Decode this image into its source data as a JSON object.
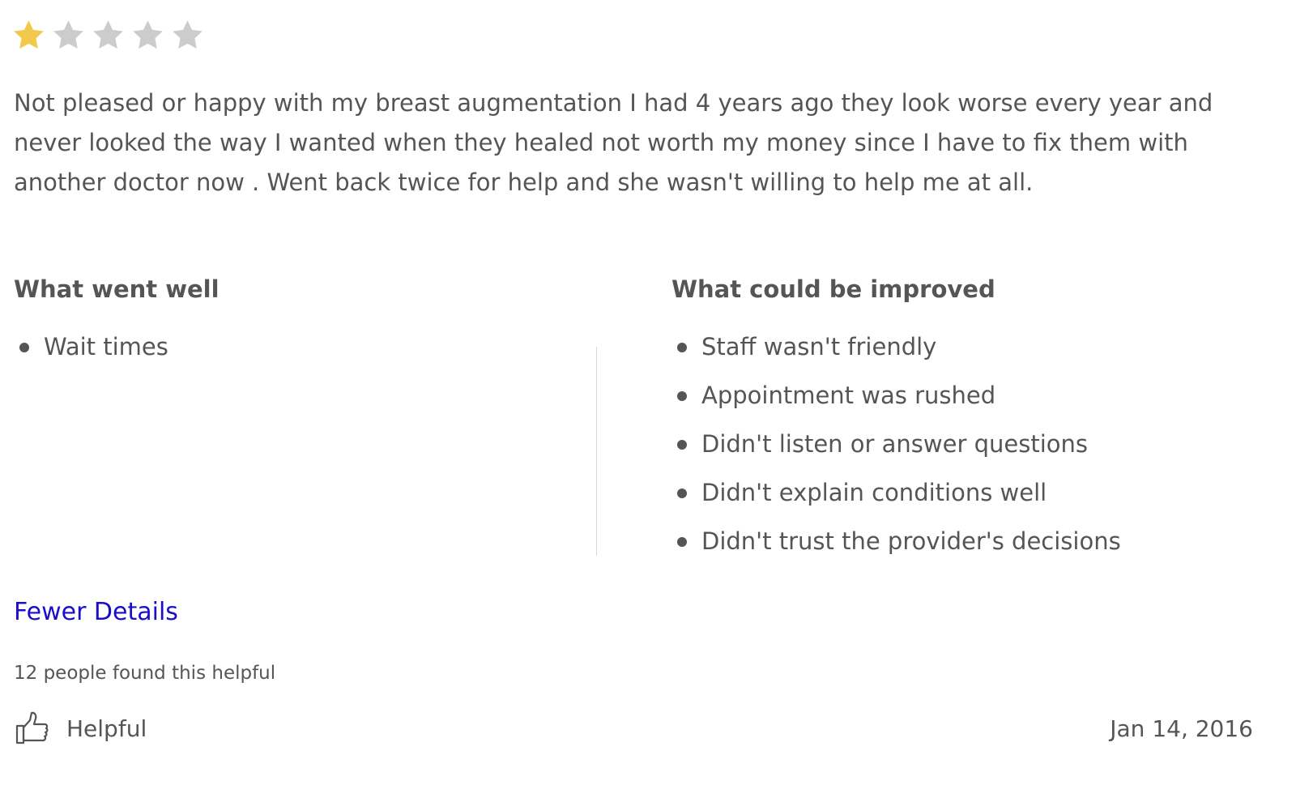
{
  "rating": {
    "value": 1,
    "max": 5,
    "filled_color": "#f2c94c",
    "empty_color": "#cccccc"
  },
  "review": {
    "text": "Not pleased or happy with my breast augmentation I had 4 years ago they look worse every year and never looked the way I wanted when they healed not worth my money since I have to fix them with another doctor now . Went back twice for help and she wasn't willing to help me at all."
  },
  "went_well": {
    "title": "What went well",
    "items": [
      "Wait times"
    ]
  },
  "could_improve": {
    "title": "What could be improved",
    "items": [
      "Staff wasn't friendly",
      "Appointment was rushed",
      "Didn't listen or answer questions",
      "Didn't explain conditions well",
      "Didn't trust the provider's decisions"
    ]
  },
  "details_toggle": {
    "label": "Fewer Details",
    "color": "#1a0dcc"
  },
  "helpful": {
    "count_text": "12 people found this helpful",
    "button_label": "Helpful",
    "icon": "thumbs-up-icon"
  },
  "date": "Jan 14, 2016"
}
